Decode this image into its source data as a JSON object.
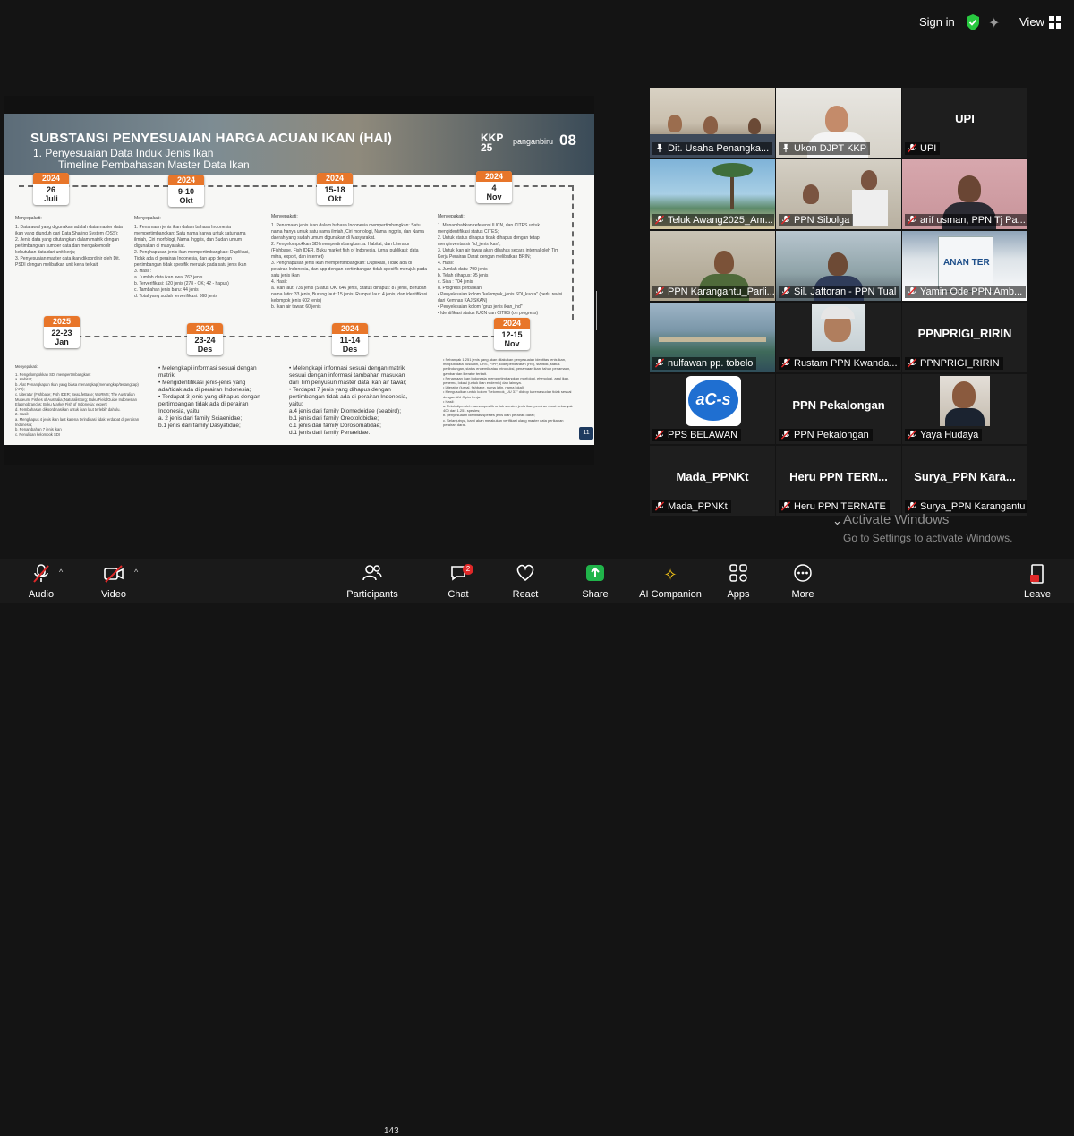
{
  "topbar": {
    "signin": "Sign in",
    "view": "View"
  },
  "slide": {
    "title": "SUBSTANSI PENYESUAIAN HARGA ACUAN IKAN (HAI)",
    "subtitle_line1": "1.    Penyesuaian Data Induk Jenis Ikan",
    "subtitle_line2": "Timeline Pembahasan Master Data Ikan",
    "logo_kkp": "KKP",
    "logo_kkp_year": "25",
    "logo_pangan": "panganbiru",
    "number": "08",
    "page": "11",
    "calendars": [
      {
        "year": "2024",
        "date": "26",
        "month": "Juli"
      },
      {
        "year": "2024",
        "date": "9-10",
        "month": "Okt"
      },
      {
        "year": "2024",
        "date": "15-18",
        "month": "Okt"
      },
      {
        "year": "2024",
        "date": "4",
        "month": "Nov"
      },
      {
        "year": "2024",
        "date": "12-15",
        "month": "Nov"
      },
      {
        "year": "2024",
        "date": "11-14",
        "month": "Des"
      },
      {
        "year": "2024",
        "date": "23-24",
        "month": "Des"
      },
      {
        "year": "2025",
        "date": "22-23",
        "month": "Jan"
      }
    ],
    "cols_top": [
      {
        "title": "Menyepakati:",
        "lines": [
          "1. Data awal yang digunakan adalah data master data ikan yang diunduh dari Data Sharing System (DSS);",
          "2. Jenis data yang ditutangkan dalam matrik dengan pertimbangkan sumber data dan mengakomodir kebutuhan data dari unit kerja;",
          "3. Penyesuaian master data ikan dikoordinir oleh Dit. PSDI dengan melibatkan unit kerja terkait."
        ]
      },
      {
        "title": "Menyepakati:",
        "lines": [
          "1. Penamaan jenis ikan dalam bahasa Indonesia mempertimbangkan: Satu nama hanya untuk satu nama ilmiah, Ciri morfologi, Nama Inggris, dan Sudah umum digunakan di masyarakat.",
          "2. Penghapusan jenis ikan mempertimbangkan: Duplikasi, Tidak ada di perairan Indonesia, dan app dengan pertimbangan tidak spesifik merujuk pada satu jenis ikan",
          "3. Hasil :",
          "a. Jumlah data ikan awal 763 jenis",
          "b. Terverifikasi: 520 jenis (278 - OK; 42 - hapus)",
          "c. Tambahan jenis baru: 44 jenis",
          "d. Total yang sudah terverifikasi: 368 jenis"
        ]
      },
      {
        "title": "Menyepakati:",
        "lines": [
          "1. Penamaan jenis ikan dalam bahasa Indonesia mempertimbangkan: Satu nama hanya untuk satu nama ilmiah, Ciri morfologi, Nama Inggris, dan Nama daerah yang sudah umum digunakan di Masyarakat.",
          "2. Pengelompokkan SDI mempertimbangkan: a. Habitat; dan Literatur (Fishbase, Fish IDER, Buku market fish of Indonesia, jurnal publikasi; data mitra, export, dan internet)",
          "3. Penghapusan jenis ikan mempertimbangkan: Duplikasi, Tidak ada di perairan Indonesia, dan app dengan pertimbangan tidak spesifik merujuk pada satu jenis ikan",
          "4. Hasil:",
          "a. Ikan laut: 739 jenis (Status OK: 646 jenis, Status dihapus: 87 jenis, Berubah nama latin: 33 jenis, Burung laut: 15 jenis, Rumput laut: 4 jenis, dan identifikasi kelompok jenis 602 jenis)",
          "b. Ikan air tawar: 60 jenis"
        ]
      },
      {
        "title": "Menyepakati:",
        "lines": [
          "1. Menambahkan referensi IUCN, dan CITES untuk mengidentifikasi status CITES;",
          "2. Untuk status dihapus tidak dihapus dengan tetap menginventarisir \"id_jenis ikan\";",
          "3. Untuk ikan air tawar akan dibahas secara internal oleh Tim Kerja Perairan Darat dengan melibatkan BRIN;",
          "4. Hasil:",
          "a. Jumlah data: 799 jenis",
          "b. Telah dihapus: 95 jenis",
          "c. Sisa : 704 jenis",
          "d. Progress perbaikan:",
          "• Penyelesaian kolom \"kelompok_jenis SDI_kuota\" (perlu revisi dari Kemnas KAJISKAN)",
          "• Penyelesaian kolom \"grup jenis ikan_ind\"",
          "• Identifikasi status IUCN dan CITES (on progress)"
        ]
      }
    ],
    "cols_bottom": [
      {
        "title": "Menyepakati:",
        "lines": [
          "1. Pengelompokkan SDI mempertimbangkan:",
          "a. Habitat;",
          "b. Alat Penangkapan Ikan yang biasa menangkap(menangkap/tertangkap) (API);",
          "c. Literatur (Fishbase; Fish IDER; SeaLifeBase; WoRMS; The Australian Museum; Fishes of Australia; Naturalist.org; Buku Field Guide Indonesian Elasmobranchs; Buku Market Fish of Indonesia; expert)",
          "d. Pembahasan dikoordinasikan untuk ikan laut terlebih dahulu.",
          "2. Hasil:",
          "a. Menghapus 4 jenis ikan laut karena terindikasi tidak terdapat di perairan Indonesia;",
          "b. Penambahan 7 jenis ikan",
          "c. Penulisan kelompok SDI"
        ]
      },
      {
        "title": "",
        "lines": [
          "• Melengkapi informasi sesuai dengan matrik;",
          "• Mengidentifikasi jenis-jenis yang ada/tidak ada di perairan Indonesia;",
          "• Terdapat 3 jenis yang dihapus dengan pertimbangan tidak ada di perairan Indonesia, yaitu:",
          "a. 2 jenis dari family Sciaenidae;",
          "b.1 jenis dari family Dasyatidae;"
        ]
      },
      {
        "title": "",
        "lines": [
          "• Melengkapi informasi sesuai dengan matrik sesuai dengan informasi tambahan masukan dari Tim penyusun master data ikan air tawar;",
          "• Terdapat 7 jenis yang dihapus dengan pertimbangan tidak ada di perairan Indonesia, yaitu:",
          "a.4 jenis dari family Diomedeidae (seabird);",
          "b.1 jenis dari family Oreotolobidae;",
          "c.1 jenis dari family Dorosomatidae;",
          "d.1 jenis dari family Penaeidae."
        ]
      },
      {
        "title": "",
        "lines": [
          "• Sebanyak 1.251 jenis yang akan dilakukan penyesuaian identitas jenis ikan, meliputi data pusdatin, DRS, PIPP, kode pendaratan (HS), statistik, status perlindungan, status endemik atau introduksi, penamaan ikan, tahun penamaan, gambar dan literatur terkait.",
          "• Penamaan ikan Indonesia mempertimbangkan morfologi, etymologi, asal ikan, penemu, lokasi (untuk ikan endemik) dan lainnya.",
          "• Literatur (jurnal, fishbase, nama latin, nama lokal).",
          "• Mengusulkan untuk kolom \"kelompok_UU 31\" didrop karena sudah tidak sesuai dengan UU Cipta Kerja.",
          "• Hasil:",
          "a. Telah diperoleh nama spesifik untuk spesies jenis ikan perairan darat sebanyak 400 dari 1.251 spesies;",
          "b. penyesuaian identitas spesies jenis ikan perairan darat;",
          "c. Selanjutnya, kami akan melakukan verifikasi ulang master data perikanan perairan darat."
        ]
      }
    ]
  },
  "tiles": [
    {
      "name": "Dit. Usaha Penangka...",
      "big": "",
      "active": true,
      "pinned": true,
      "muted": false,
      "bg": "office"
    },
    {
      "name": "Ukon DJPT KKP",
      "big": "",
      "active": false,
      "pinned": true,
      "muted": false,
      "bg": "man-white"
    },
    {
      "name": "UPI",
      "big": "UPI",
      "active": false,
      "pinned": false,
      "muted": true,
      "bg": "none"
    },
    {
      "name": "Teluk Awang2025_Am...",
      "big": "",
      "active": false,
      "pinned": false,
      "muted": true,
      "bg": "beach"
    },
    {
      "name": "PPN Sibolga",
      "big": "",
      "active": false,
      "pinned": false,
      "muted": true,
      "bg": "office2"
    },
    {
      "name": "arif usman, PPN Tj Pa...",
      "big": "",
      "active": false,
      "pinned": false,
      "muted": true,
      "bg": "pink"
    },
    {
      "name": "PPN Karangantu_Parli...",
      "big": "",
      "active": false,
      "pinned": false,
      "muted": true,
      "bg": "man-green"
    },
    {
      "name": "Sil. Jaftoran - PPN Tual",
      "big": "",
      "active": false,
      "pinned": false,
      "muted": true,
      "bg": "outdoor"
    },
    {
      "name": "Yamin Ode PPN Amb...",
      "big": "",
      "active": false,
      "pinned": false,
      "muted": true,
      "bg": "building"
    },
    {
      "name": "nulfawan pp. tobelo",
      "big": "",
      "active": false,
      "pinned": false,
      "muted": true,
      "bg": "harbor"
    },
    {
      "name": "Rustam PPN Kwanda...",
      "big": "",
      "active": false,
      "pinned": false,
      "muted": true,
      "bg": "woman"
    },
    {
      "name": "PPNPRIGI_RIRIN",
      "big": "PPNPRIGI_RIRIN",
      "active": false,
      "pinned": false,
      "muted": true,
      "bg": "none"
    },
    {
      "name": "PPS BELAWAN",
      "big": "",
      "active": false,
      "pinned": false,
      "muted": true,
      "bg": "logo"
    },
    {
      "name": "PPN Pekalongan",
      "big": "PPN Pekalongan",
      "active": false,
      "pinned": false,
      "muted": true,
      "bg": "none"
    },
    {
      "name": "Yaya Hudaya",
      "big": "",
      "active": false,
      "pinned": false,
      "muted": true,
      "bg": "man-avatar"
    },
    {
      "name": "Mada_PPNKt",
      "big": "Mada_PPNKt",
      "active": false,
      "pinned": false,
      "muted": true,
      "bg": "none"
    },
    {
      "name": "Heru PPN TERNATE",
      "big": "Heru  PPN  TERN...",
      "active": false,
      "pinned": false,
      "muted": true,
      "bg": "none"
    },
    {
      "name": "Surya_PPN Karangantu",
      "big": "Surya_PPN  Kara...",
      "active": false,
      "pinned": false,
      "muted": true,
      "bg": "none"
    }
  ],
  "logo_text": "aC-s",
  "watermark": {
    "line1": "Activate Windows",
    "line2": "Go to Settings to activate Windows."
  },
  "toolbar": {
    "audio": "Audio",
    "video": "Video",
    "participants": "Participants",
    "participants_count": "143",
    "chat": "Chat",
    "chat_badge": "2",
    "react": "React",
    "share": "Share",
    "ai": "AI Companion",
    "apps": "Apps",
    "more": "More",
    "leave": "Leave"
  },
  "colors": {
    "accent_green": "#28c840",
    "muted_red": "#e02828",
    "share_green": "#20b44a",
    "calendar_orange": "#e8762a"
  }
}
